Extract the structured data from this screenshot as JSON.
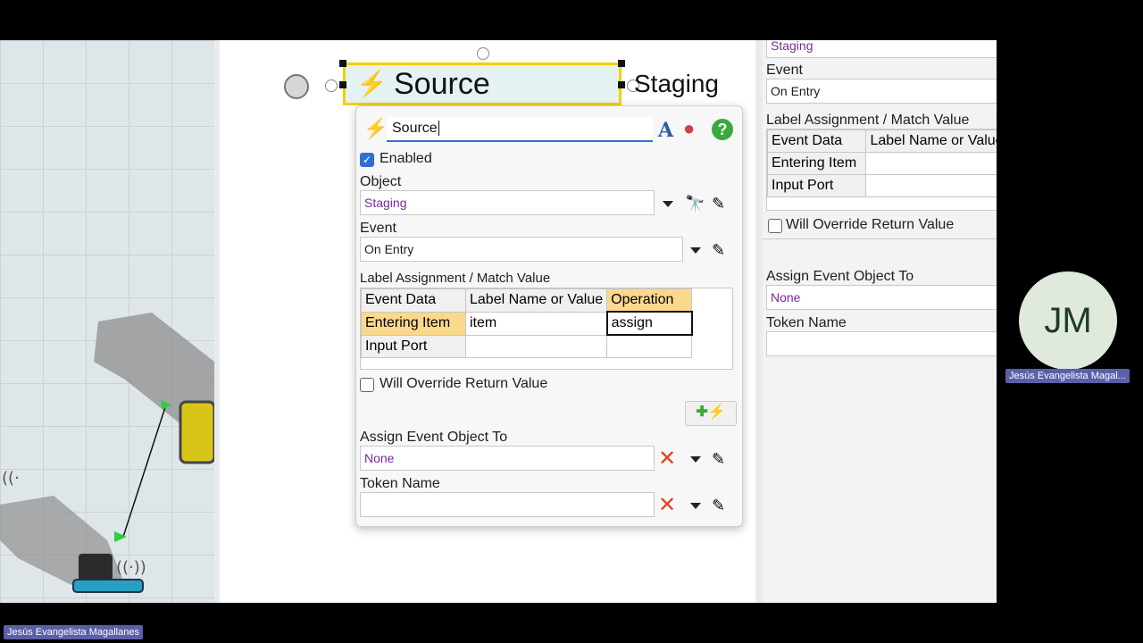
{
  "canvas": {
    "source_block_title": "Source",
    "staging_label": "Staging"
  },
  "popup": {
    "name_value": "Source",
    "enabled_label": "Enabled",
    "object_label": "Object",
    "object_value": "Staging",
    "event_label": "Event",
    "event_value": "On Entry",
    "label_assignment_heading": "Label Assignment / Match Value",
    "table_headers": [
      "Event Data",
      "Label Name or Value",
      "Operation"
    ],
    "table_rows": [
      [
        "Entering Item",
        "item",
        "assign"
      ],
      [
        "Input Port",
        "",
        ""
      ]
    ],
    "override_label": "Will Override Return Value",
    "assign_event_object_label": "Assign Event Object To",
    "assign_event_object_value": "None",
    "token_name_label": "Token Name",
    "token_name_value": ""
  },
  "props": {
    "object_value": "Staging",
    "event_label": "Event",
    "event_value": "On Entry",
    "label_assignment_heading": "Label Assignment / Match Value",
    "table_headers": [
      "Event Data",
      "Label Name or Value"
    ],
    "table_rows": [
      [
        "Entering Item",
        ""
      ],
      [
        "Input Port",
        ""
      ]
    ],
    "override_label": "Will Override Return Value",
    "assign_event_object_label": "Assign Event Object To",
    "assign_event_object_value": "None",
    "token_name_label": "Token Name"
  },
  "participant": {
    "initials": "JM",
    "name": "Jesús Evangelista Magal...",
    "bottom_name": "Jesús Evangelista Magallanes"
  },
  "colors": {
    "accent_yellow": "#f4d000",
    "selected_row": "#fcd88d",
    "avatar_bg": "#dfe9dc",
    "name_badge": "#5b5fa8"
  },
  "icons": [
    "source-activity-icon",
    "font-icon",
    "color-palette-icon",
    "help-icon",
    "binoculars-icon",
    "eyedropper-icon",
    "delete-x-icon",
    "add-event-icon"
  ]
}
